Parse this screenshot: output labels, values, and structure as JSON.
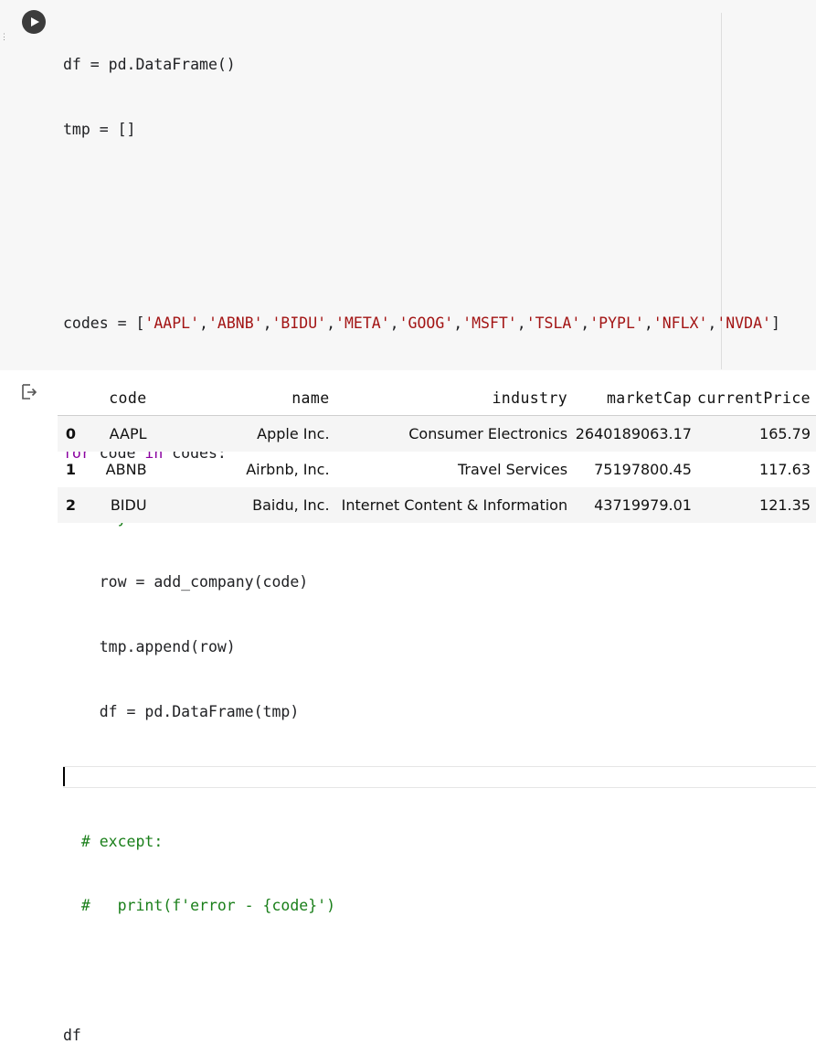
{
  "code_cell": {
    "lines": [
      "df = pd.DataFrame()",
      "tmp = []",
      "",
      "",
      "codes = ['AAPL','ABNB','BIDU','META','GOOG','MSFT','TSLA','PYPL','NFLX','NVDA']",
      "",
      "for code in codes:",
      "  # try:",
      "    row = add_company(code)",
      "    tmp.append(row)",
      "    df = pd.DataFrame(tmp)",
      "",
      "  # except:",
      "  #   print(f'error - {code}')",
      "",
      "df"
    ],
    "active_line": 11
  },
  "output": {
    "table": {
      "columns": [
        "code",
        "name",
        "industry",
        "marketCap",
        "currentPrice"
      ],
      "rows": [
        {
          "index": "0",
          "code": "AAPL",
          "name": "Apple Inc.",
          "industry": "Consumer Electronics",
          "marketCap": "2640189063.17",
          "currentPrice": "165.79"
        },
        {
          "index": "1",
          "code": "ABNB",
          "name": "Airbnb, Inc.",
          "industry": "Travel Services",
          "marketCap": "75197800.45",
          "currentPrice": "117.63"
        },
        {
          "index": "2",
          "code": "BIDU",
          "name": "Baidu, Inc.",
          "industry": "Internet Content & Information",
          "marketCap": "43719979.01",
          "currentPrice": "121.35"
        }
      ]
    }
  },
  "icons": {
    "run": "play-circle-icon",
    "output": "output-arrow-icon"
  }
}
